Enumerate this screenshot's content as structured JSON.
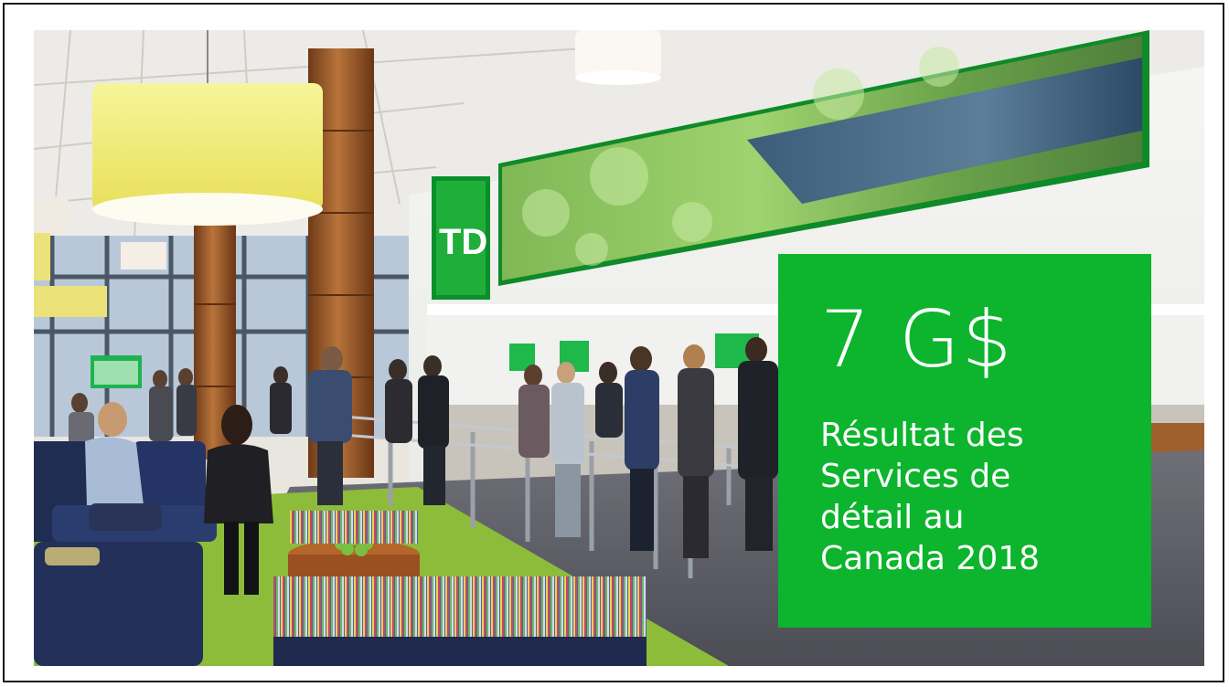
{
  "stat": {
    "value": "7 G$",
    "caption": "Résultat des Services de détail au Canada 2018"
  },
  "photo": {
    "signage_logo": "TD"
  },
  "colors": {
    "brand_green": "#0cb52d",
    "signage_green": "#1a9b2a",
    "wood": "#9a5a2a",
    "lamp_yellow": "#f2ef7a"
  }
}
